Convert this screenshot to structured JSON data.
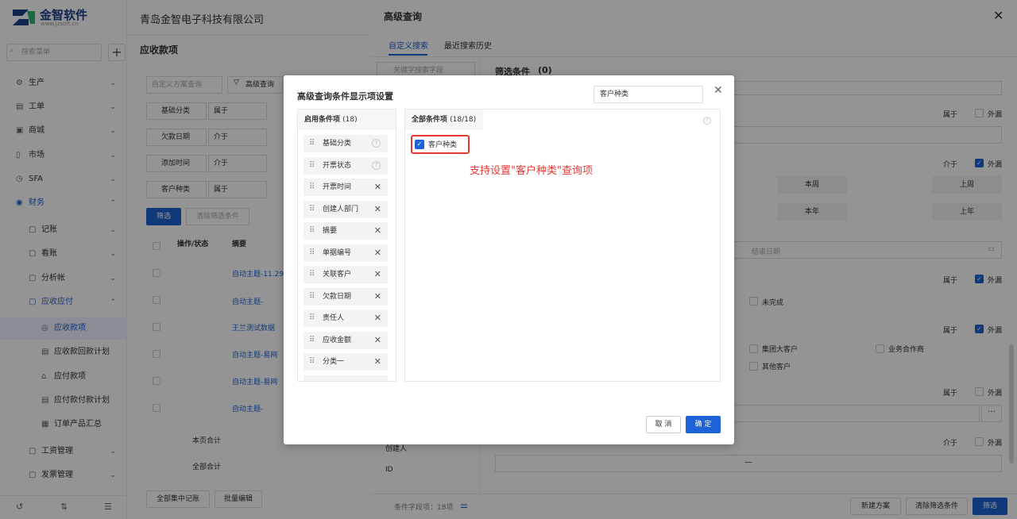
{
  "brand": {
    "name": "金智软件",
    "url": "www.jzsoft.cn"
  },
  "company": "青岛金智电子科技有限公司",
  "sidebar": {
    "search_placeholder": "搜索菜单",
    "items": [
      {
        "label": "生产",
        "icon": "production-icon"
      },
      {
        "label": "工单",
        "icon": "workorder-icon"
      },
      {
        "label": "商城",
        "icon": "mall-icon"
      },
      {
        "label": "市场",
        "icon": "market-icon"
      },
      {
        "label": "SFA",
        "icon": "sfa-icon"
      },
      {
        "label": "财务",
        "icon": "finance-icon"
      },
      {
        "label": "记账",
        "icon": "bookkeeping-icon"
      },
      {
        "label": "看账",
        "icon": "ledger-icon"
      },
      {
        "label": "分析帐",
        "icon": "analysis-icon"
      },
      {
        "label": "应收应付",
        "icon": "receivable-icon"
      },
      {
        "label": "应收款项",
        "icon": "receivable-item-icon"
      },
      {
        "label": "应收款回款计划",
        "icon": "plan-icon"
      },
      {
        "label": "应付款项",
        "icon": "payable-icon"
      },
      {
        "label": "应付款付款计划",
        "icon": "payplan-icon"
      },
      {
        "label": "订单产品汇总",
        "icon": "summary-icon"
      },
      {
        "label": "工资管理",
        "icon": "salary-icon"
      },
      {
        "label": "发票管理",
        "icon": "invoice-icon"
      }
    ]
  },
  "page": {
    "title": "应收款项",
    "scheme_placeholder": "自定义方案查询",
    "advanced_search": "高级查询",
    "filters": [
      {
        "field": "基础分类",
        "op": "属于"
      },
      {
        "field": "欠款日期",
        "op": "介于"
      },
      {
        "field": "添加时间",
        "op": "介于"
      },
      {
        "field": "客户种类",
        "op": "属于"
      }
    ],
    "filter_button": "筛选",
    "clear_button": "清除筛选条件",
    "columns": {
      "ops": "操作/状态",
      "summary": "摘要"
    },
    "rows": [
      "自动主题-11.29",
      "自动主题-",
      "王兰测试数据",
      "自动主题-易网",
      "自动主题-易网",
      "自动主题-"
    ],
    "page_total": "本页合计",
    "all_total": "全部合计",
    "bulk_book": "全部集中记账",
    "bulk_edit": "批量编辑"
  },
  "drawer": {
    "title": "高级查询",
    "tabs": [
      "自定义搜索",
      "最近搜索历史"
    ],
    "search_placeholder": "关键字搜索字段",
    "conditions_label": "筛选条件",
    "conditions_count": "(0)",
    "ops": [
      "属于",
      "介于",
      "属于",
      "属于",
      "属于",
      "介于"
    ],
    "outer": "外漏",
    "date_buttons": [
      "本周",
      "上周",
      "本年",
      "上年"
    ],
    "end_date": "结束日期",
    "unfinished": "未完成",
    "customer_types": [
      "集团大客户",
      "业务合作商",
      "其他客户"
    ],
    "left_fields": [
      "创建人",
      "ID"
    ],
    "range_dash": "一",
    "more": "···",
    "footer_count": "条件字段项：18项",
    "new_scheme": "新建方案",
    "clear": "清除筛选条件",
    "filter": "筛选"
  },
  "modal": {
    "title": "高级查询条件显示项设置",
    "search_value": "客户种类",
    "enabled_title": "启用条件项",
    "enabled_count": "(18)",
    "enabled_items": [
      "基础分类",
      "开票状态",
      "开票时间",
      "创建人部门",
      "摘要",
      "单据编号",
      "关联客户",
      "欠款日期",
      "责任人",
      "应收金额",
      "分类一"
    ],
    "all_title": "全部条件项",
    "all_count": "(18/18)",
    "match_item": "客户种类",
    "annotation": "支持设置\"客户种类\"查询项",
    "cancel": "取 消",
    "ok": "确 定"
  }
}
